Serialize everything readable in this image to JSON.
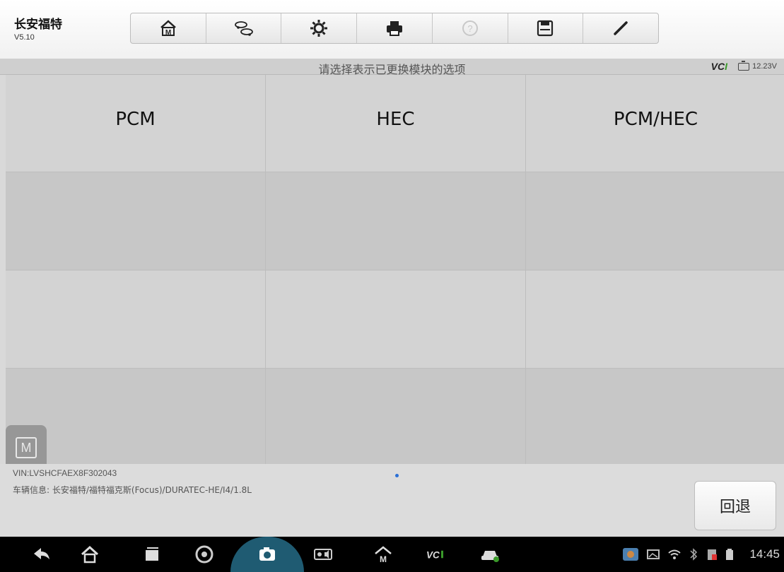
{
  "app": {
    "name": "长安福特",
    "version": "V5.10"
  },
  "toolbar": {
    "buttons": [
      {
        "icon": "home-icon"
      },
      {
        "icon": "vehicle-swap-icon"
      },
      {
        "icon": "gear-icon"
      },
      {
        "icon": "print-icon"
      },
      {
        "icon": "help-icon"
      },
      {
        "icon": "save-icon"
      },
      {
        "icon": "edit-icon"
      }
    ]
  },
  "titlebar": {
    "title": "请选择表示已更换模块的选项",
    "vci": "VCI",
    "voltage": "12.23V"
  },
  "grid": {
    "options": [
      "PCM",
      "HEC",
      "PCM/HEC",
      "",
      "",
      "",
      "",
      "",
      "",
      "",
      "",
      ""
    ]
  },
  "footer": {
    "vin": "VIN:LVSHCFAEX8F302043",
    "vehicle_info": "车辆信息: 长安福特/福特福克斯(Focus)/DURATEC-HE/I4/1.8L",
    "back_label": "回退"
  },
  "floating_button": {
    "label": "M"
  },
  "statusbar": {
    "time": "14:45"
  },
  "colors": {
    "accent_green": "#3a9a2a",
    "nav_highlight": "#1f5b72"
  }
}
